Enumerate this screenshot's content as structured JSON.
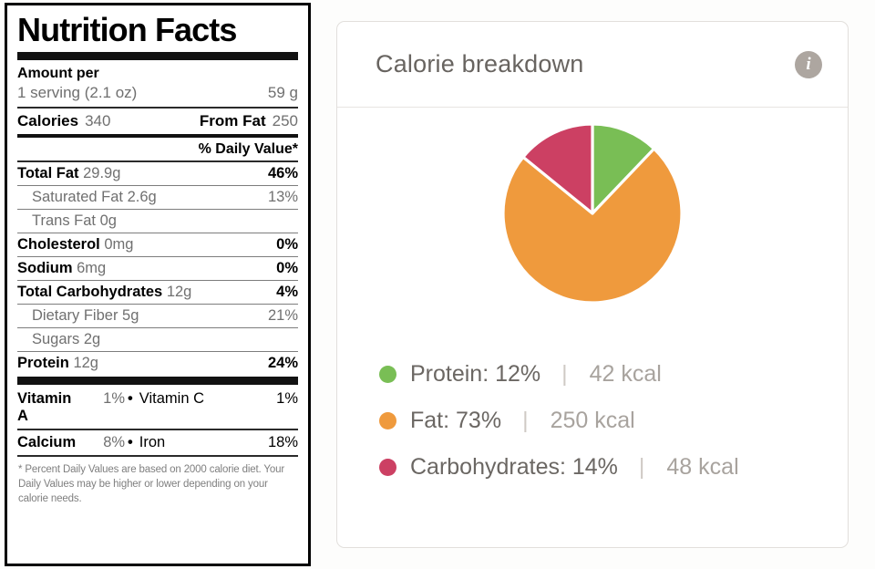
{
  "nutrition_label": {
    "title": "Nutrition Facts",
    "amount_per_label": "Amount per",
    "serving_text": "1 serving (2.1 oz)",
    "serving_weight": "59 g",
    "calories_label": "Calories",
    "calories_value": "340",
    "from_fat_label": "From Fat",
    "from_fat_value": "250",
    "daily_value_header": "% Daily Value*",
    "rows": [
      {
        "name": "Total Fat",
        "amount": "29.9g",
        "dv": "46%",
        "sub": false
      },
      {
        "name": "Saturated Fat",
        "amount": "2.6g",
        "dv": "13%",
        "sub": true
      },
      {
        "name": "Trans Fat",
        "amount": "0g",
        "dv": "",
        "sub": true
      },
      {
        "name": "Cholesterol",
        "amount": "0mg",
        "dv": "0%",
        "sub": false
      },
      {
        "name": "Sodium",
        "amount": "6mg",
        "dv": "0%",
        "sub": false
      },
      {
        "name": "Total Carbohydrates",
        "amount": "12g",
        "dv": "4%",
        "sub": false
      },
      {
        "name": "Dietary Fiber",
        "amount": "5g",
        "dv": "21%",
        "sub": true
      },
      {
        "name": "Sugars",
        "amount": "2g",
        "dv": "",
        "sub": true
      },
      {
        "name": "Protein",
        "amount": "12g",
        "dv": "24%",
        "sub": false
      }
    ],
    "vitamins": [
      {
        "left_name": "Vitamin A",
        "left_value": "1%",
        "separator": "•",
        "right_name": "Vitamin C",
        "right_value": "1%"
      },
      {
        "left_name": "Calcium",
        "left_value": "8%",
        "separator": "•",
        "right_name": "Iron",
        "right_value": "18%"
      }
    ],
    "footnote": "* Percent Daily Values are based on 2000 calorie diet. Your Daily Values may be higher or lower depending on your calorie needs."
  },
  "calorie_breakdown": {
    "title": "Calorie breakdown",
    "info_icon": "info-icon",
    "info_glyph": "i",
    "legend": [
      {
        "label": "Protein:",
        "percent": "12%",
        "separator": "|",
        "kcal": "42 kcal",
        "color": "#79be55"
      },
      {
        "label": "Fat:",
        "percent": "73%",
        "separator": "|",
        "kcal": "250 kcal",
        "color": "#ef9a3d"
      },
      {
        "label": "Carbohydrates:",
        "percent": "14%",
        "separator": "|",
        "kcal": "48 kcal",
        "color": "#cc4063"
      }
    ]
  },
  "chart_data": {
    "type": "pie",
    "title": "Calorie breakdown",
    "labels": [
      "Protein",
      "Fat",
      "Carbohydrates"
    ],
    "values": [
      12,
      73,
      14
    ],
    "kcal": [
      42,
      250,
      48
    ],
    "unit": "%",
    "total_kcal": 340,
    "colors": [
      "#79be55",
      "#ef9a3d",
      "#cc4063"
    ],
    "start_angle_deg": 0,
    "direction": "clockwise",
    "slice_gap": true,
    "legend_position": "below",
    "grid": false
  }
}
